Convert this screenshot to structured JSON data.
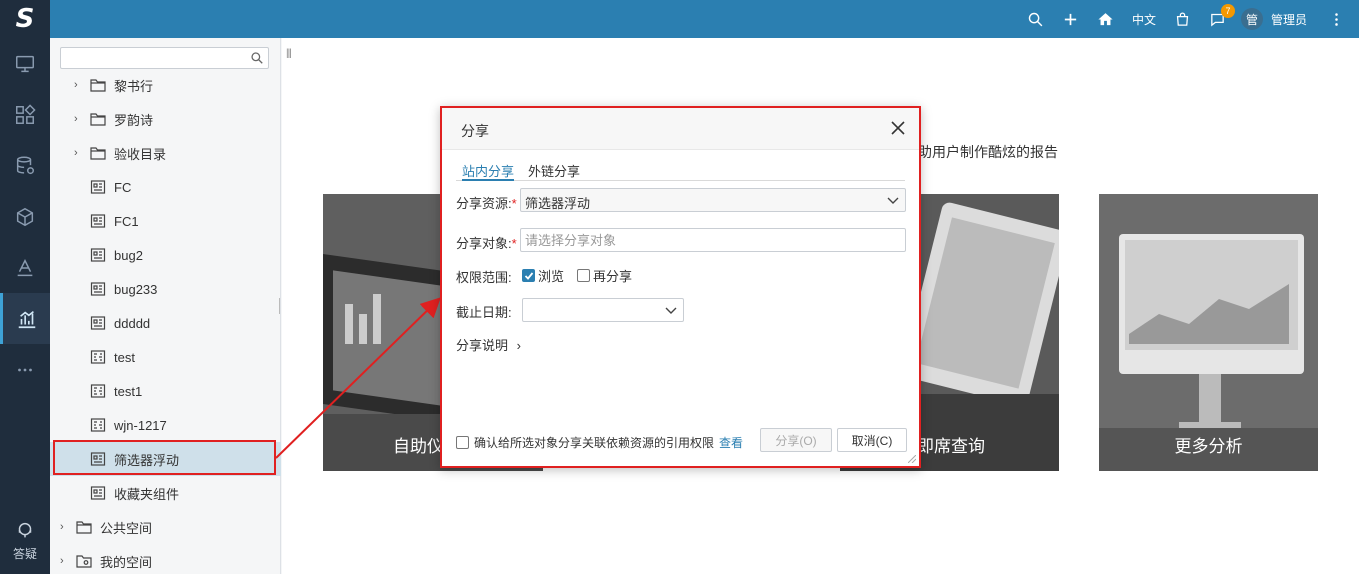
{
  "app": {
    "logo": "S"
  },
  "rail": {
    "items": [
      {
        "icon": "monitor-icon"
      },
      {
        "icon": "dashboard-icon"
      },
      {
        "icon": "database-icon"
      },
      {
        "icon": "cube-icon"
      },
      {
        "icon": "layers-icon"
      },
      {
        "icon": "bar-chart-icon",
        "active": true
      },
      {
        "icon": "more-icon"
      }
    ],
    "help_label": "答疑"
  },
  "topbar": {
    "language": "中文",
    "notification_count": "7",
    "avatar_text": "管",
    "username": "管理员"
  },
  "tree": {
    "search_placeholder": "",
    "rows": [
      {
        "label": "黎书行",
        "type": "folder",
        "expandable": true,
        "level": 1
      },
      {
        "label": "罗韵诗",
        "type": "folder",
        "expandable": true,
        "level": 1
      },
      {
        "label": "验收目录",
        "type": "folder",
        "expandable": true,
        "level": 1
      },
      {
        "label": "FC",
        "type": "report",
        "level": 2
      },
      {
        "label": "FC1",
        "type": "report",
        "level": 2
      },
      {
        "label": "bug2",
        "type": "report",
        "level": 2
      },
      {
        "label": "bug233",
        "type": "report",
        "level": 2
      },
      {
        "label": "ddddd",
        "type": "report",
        "level": 2
      },
      {
        "label": "test",
        "type": "dashboard",
        "level": 2
      },
      {
        "label": "test1",
        "type": "dashboard",
        "level": 2
      },
      {
        "label": "wjn-1217",
        "type": "dashboard",
        "level": 2
      },
      {
        "label": "筛选器浮动",
        "type": "report",
        "level": 2,
        "selected": true
      },
      {
        "label": "收藏夹组件",
        "type": "report",
        "level": 2
      },
      {
        "label": "公共空间",
        "type": "folder",
        "expandable": true,
        "level": 0
      },
      {
        "label": "我的空间",
        "type": "user-folder",
        "expandable": true,
        "level": 0
      }
    ]
  },
  "main": {
    "slogan": "助用户制作酷炫的报告",
    "cards": [
      {
        "title": "自助仪"
      },
      {
        "title": "即席查询"
      },
      {
        "title": "更多分析"
      }
    ]
  },
  "dialog": {
    "title": "分享",
    "tabs": [
      {
        "label": "站内分享",
        "active": true
      },
      {
        "label": "外链分享",
        "active": false
      }
    ],
    "resource_label": "分享资源:",
    "resource_value": "筛选器浮动",
    "target_label": "分享对象:",
    "target_placeholder": "请选择分享对象",
    "scope_label": "权限范围:",
    "scope_browse": "浏览",
    "scope_reshare": "再分享",
    "deadline_label": "截止日期:",
    "deadline_value": "",
    "description_label": "分享说明",
    "footer_confirm": "确认给所选对象分享关联依赖资源的引用权限",
    "footer_link": "查看",
    "share_button": "分享(O)",
    "cancel_button": "取消(C)"
  },
  "colors": {
    "rail_bg": "#1f2d3d",
    "topbar_bg": "#2b7fb1",
    "accent": "#2b7fb1",
    "highlight": "#e02020",
    "badge": "#f39800"
  }
}
